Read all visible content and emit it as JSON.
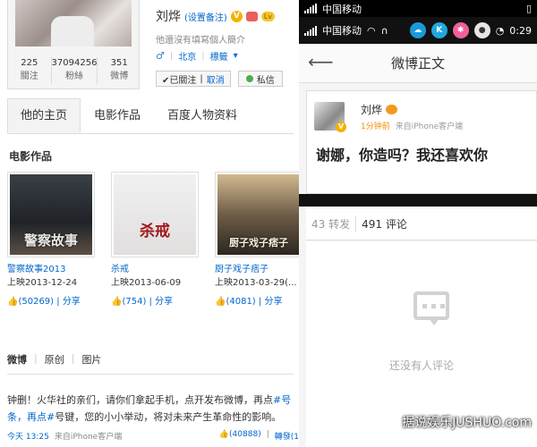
{
  "profile": {
    "name": "刘烨",
    "verify_link": "(设置备注)",
    "level_badge": "Lv",
    "bio": "他還沒有填寫個人簡介",
    "location": "北京",
    "tags": "標籤",
    "stats": [
      {
        "num": "225",
        "label": "關注"
      },
      {
        "num": "37094256",
        "label": "粉絲"
      },
      {
        "num": "351",
        "label": "微博"
      }
    ],
    "followed_label": "✔已關注",
    "cancel_label": "取消",
    "pm_label": "私信"
  },
  "tabs": [
    "他的主页",
    "电影作品",
    "百度人物资料"
  ],
  "movies_section": {
    "title": "电影作品",
    "items": [
      {
        "poster_text": "警察故事",
        "title": "警察故事2013",
        "date": "上映2013-12-24",
        "likes": "(50269)",
        "share": "分享"
      },
      {
        "poster_text": "杀戒",
        "title": "杀戒",
        "date": "上映2013-06-09",
        "likes": "(754)",
        "share": "分享"
      },
      {
        "poster_text": "厨子戏子痞子",
        "title": "厨子戏子痞子",
        "date": "上映2013-03-29(...",
        "likes": "(4081)",
        "share": "分享"
      }
    ]
  },
  "feed": {
    "tabs": [
      "微博",
      "原创",
      "图片"
    ],
    "post_line1_prefix": "钟删！火华社的亲们，请你们拿起手机，点开发布微博，再点",
    "post_line1_hash": "#号",
    "post_line2_hash": "条，再点#",
    "post_line2_rest": "号键，您的小小举动，将对未来产生革命性的影响。",
    "time": "今天 13:25",
    "source": "来自iPhone客户端",
    "likes": "(40888)",
    "repost": "轉發(1"
  },
  "phone": {
    "carrier1": "中国移动",
    "carrier2": "中国移动",
    "clock": "0:29",
    "header_title": "微博正文",
    "post_name": "刘烨",
    "post_time": "1分钟前",
    "post_source": "来自iPhone客户端",
    "post_content": "谢娜，你造吗？我还喜欢你",
    "reposts": "43 转发",
    "comments": "491 评论",
    "empty_text": "还没有人评论",
    "watermark": "据说娱乐JUSHUO.com"
  },
  "colors": {
    "link": "#0066cc",
    "badge_gold": "#f6b100"
  }
}
